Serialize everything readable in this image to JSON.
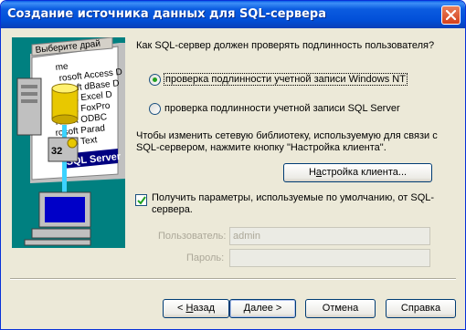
{
  "window": {
    "title": "Создание источника данных для SQL-сервера"
  },
  "side_panel": {
    "items": [
      "Выберите драй",
      "me",
      "rosoft Access D",
      "rosoft dBase D",
      "rosoft Excel D",
      "rosoft FoxPro",
      "rosoft ODBC",
      "rosoft Parad",
      "rosoft Text",
      "SQL Server"
    ]
  },
  "auth": {
    "question": "Как SQL-сервер должен проверять подлинность пользователя?",
    "option_nt": "проверка подлинности учетной записи Windows NT",
    "option_sql": "проверка подлинности учетной записи SQL Server",
    "selected": "option_nt"
  },
  "client": {
    "info": "Чтобы изменить сетевую библиотеку, используемую для связи с SQL-сервером, нажмите кнопку \"Настройка клиента\".",
    "button_pre": "Н",
    "button_key": "а",
    "button_post": "стройка клиента..."
  },
  "defaults": {
    "checkbox_label": "Получить параметры, используемые по умолчанию, от SQL-сервера.",
    "checked": true,
    "user_label": "Пользователь:",
    "user_value": "admin",
    "password_label": "Пароль:",
    "password_value": ""
  },
  "buttons": {
    "back_pre": "< ",
    "back_key": "Н",
    "back_post": "азад",
    "next_key": "Д",
    "next_post": "алее >",
    "cancel": "Отмена",
    "help": "Справка"
  },
  "colors": {
    "titlebar": "#0250d8",
    "dialog_bg": "#ece9d8",
    "side_bg": "#008080",
    "radio_dot": "#21a121"
  }
}
